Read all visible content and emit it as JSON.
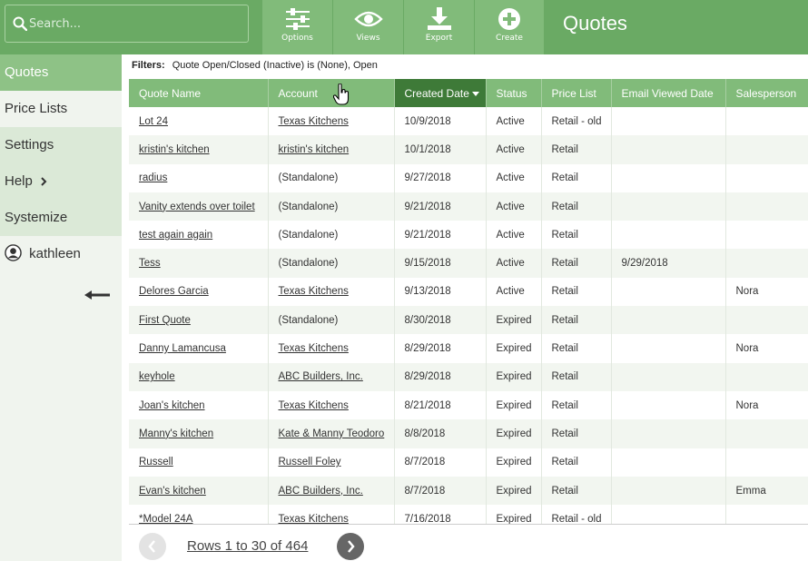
{
  "search": {
    "placeholder": "Search..."
  },
  "toolbar": {
    "options_label": "Options",
    "views_label": "Views",
    "export_label": "Export",
    "create_label": "Create"
  },
  "page_title": "Quotes",
  "sidebar": {
    "items": [
      {
        "label": "Quotes"
      },
      {
        "label": "Price Lists"
      },
      {
        "label": "Settings"
      },
      {
        "label": "Help"
      },
      {
        "label": "Systemize"
      }
    ],
    "user": "kathleen"
  },
  "filters": {
    "label": "Filters:",
    "text": "Quote Open/Closed (Inactive) is (None), Open"
  },
  "table": {
    "columns": [
      "Quote Name",
      "Account",
      "Created Date",
      "Status",
      "Price List",
      "Email Viewed Date",
      "Salesperson"
    ],
    "rows": [
      [
        "Lot 24",
        "Texas Kitchens",
        "10/9/2018",
        "Active",
        "Retail - old",
        "",
        ""
      ],
      [
        "kristin's kitchen",
        "kristin's kitchen",
        "10/1/2018",
        "Active",
        "Retail",
        "",
        ""
      ],
      [
        "radius",
        "(Standalone)",
        "9/27/2018",
        "Active",
        "Retail",
        "",
        ""
      ],
      [
        "Vanity extends over toilet",
        "(Standalone)",
        "9/21/2018",
        "Active",
        "Retail",
        "",
        ""
      ],
      [
        "test again again",
        "(Standalone)",
        "9/21/2018",
        "Active",
        "Retail",
        "",
        ""
      ],
      [
        "Tess",
        "(Standalone)",
        "9/15/2018",
        "Active",
        "Retail",
        "9/29/2018",
        ""
      ],
      [
        "Delores Garcia",
        "Texas Kitchens",
        "9/13/2018",
        "Active",
        "Retail",
        "",
        "Nora"
      ],
      [
        "First Quote",
        "(Standalone)",
        "8/30/2018",
        "Expired",
        "Retail",
        "",
        ""
      ],
      [
        "Danny Lamancusa",
        "Texas Kitchens",
        "8/29/2018",
        "Expired",
        "Retail",
        "",
        "Nora"
      ],
      [
        "keyhole",
        "ABC Builders, Inc.",
        "8/29/2018",
        "Expired",
        "Retail",
        "",
        ""
      ],
      [
        "Joan's kitchen",
        "Texas Kitchens",
        "8/21/2018",
        "Expired",
        "Retail",
        "",
        "Nora"
      ],
      [
        "Manny's kitchen",
        "Kate & Manny Teodoro",
        "8/8/2018",
        "Expired",
        "Retail",
        "",
        ""
      ],
      [
        "Russell",
        "Russell Foley",
        "8/7/2018",
        "Expired",
        "Retail",
        "",
        ""
      ],
      [
        "Evan's kitchen",
        "ABC Builders, Inc.",
        "8/7/2018",
        "Expired",
        "Retail",
        "",
        "Emma"
      ],
      [
        "*Model 24A",
        "Texas Kitchens",
        "7/16/2018",
        "Expired",
        "Retail - old",
        "",
        ""
      ]
    ]
  },
  "pager": {
    "rows_text": "Rows 1 to 30 of 464"
  },
  "colors": {
    "brand": "#6aaa64",
    "header": "#81bb7a",
    "sorted_header": "#3e7a38"
  }
}
